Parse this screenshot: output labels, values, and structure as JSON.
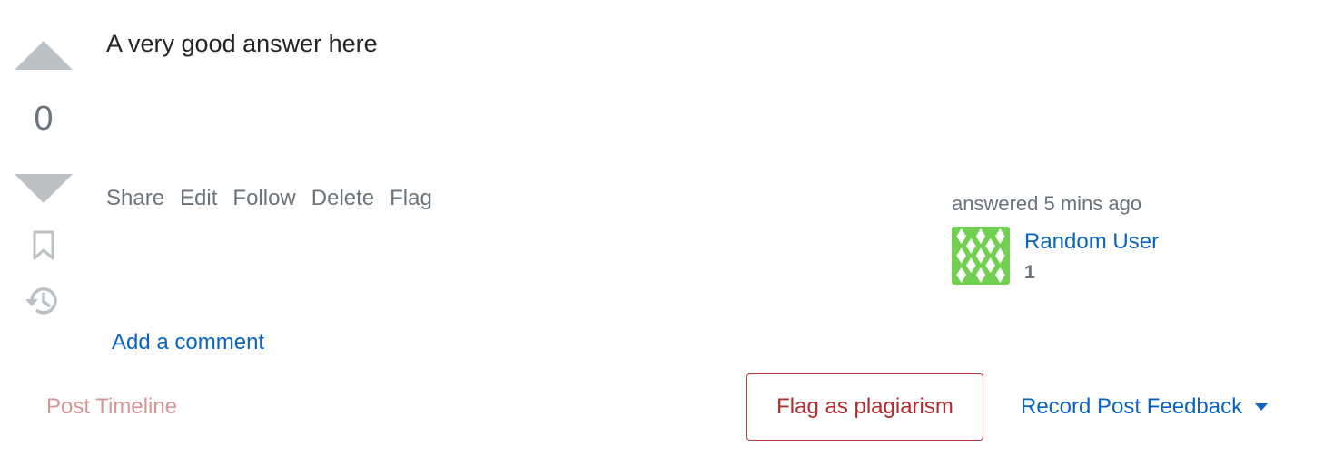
{
  "vote": {
    "count": "0",
    "upvote_icon": "triangle-up-icon",
    "downvote_icon": "triangle-down-icon",
    "bookmark_icon": "bookmark-icon",
    "history_icon": "history-icon"
  },
  "post": {
    "body": "A very good answer here"
  },
  "menu": {
    "share": "Share",
    "edit": "Edit",
    "follow": "Follow",
    "delete": "Delete",
    "flag": "Flag"
  },
  "signature": {
    "action_time": "answered 5 mins ago",
    "user_name": "Random User",
    "reputation": "1",
    "avatar_icon": "identicon-avatar"
  },
  "comments": {
    "add_label": "Add a comment"
  },
  "bottom": {
    "timeline_label": "Post Timeline",
    "flag_plagiarism_label": "Flag as plagiarism",
    "record_feedback_label": "Record Post Feedback",
    "dropdown_icon": "caret-down-icon"
  },
  "colors": {
    "link_blue": "#0a64bf",
    "muted_text": "#6a737c",
    "vote_arrow": "#bbc0c4",
    "danger_red": "#c0383a",
    "timeline_pink": "#d79696",
    "avatar_green": "#71d04f"
  }
}
